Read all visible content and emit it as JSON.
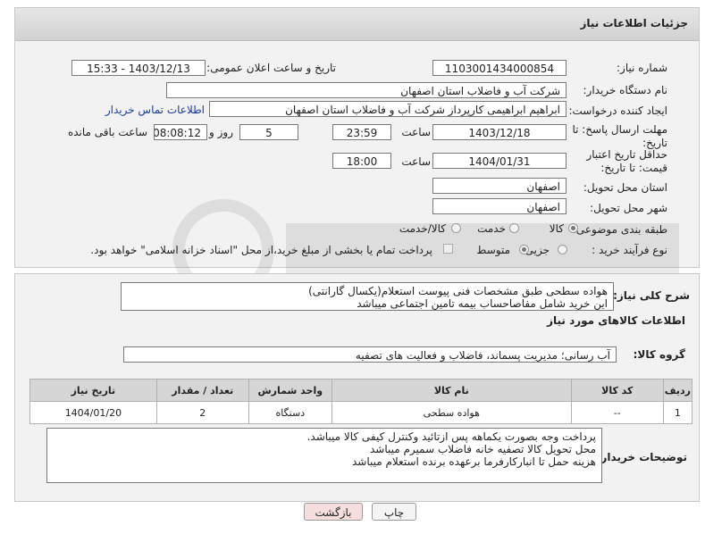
{
  "header": {
    "title": "جزئیات اطلاعات نیاز"
  },
  "fields": {
    "need_number_label": "شماره نیاز:",
    "need_number": "1103001434000854",
    "announce_label": "تاریخ و ساعت اعلان عمومی:",
    "announce_value": "1403/12/13 - 15:33",
    "buyer_org_label": "نام دستگاه خریدار:",
    "buyer_org": "شرکت آب و فاضلاب استان اصفهان",
    "creator_label": "ایجاد کننده درخواست:",
    "creator": "ابراهیم ابراهیمی کارپرداز شرکت آب و فاضلاب استان اصفهان",
    "contact_link": "اطلاعات تماس خریدار",
    "deadline_label": "مهلت ارسال پاسخ: تا تاریخ:",
    "deadline_date": "1403/12/18",
    "time_label": "ساعت",
    "deadline_time": "23:59",
    "days_remaining": "5",
    "days_and_label": "روز و",
    "time_remaining": "08:08:12",
    "remaining_label": "ساعت باقی مانده",
    "validity_label": "حداقل تاریخ اعتبار قیمت: تا تاریخ:",
    "validity_date": "1404/01/31",
    "validity_time": "18:00",
    "province_label": "استان محل تحویل:",
    "province": "اصفهان",
    "city_label": "شهر محل تحویل:",
    "city": "اصفهان",
    "category_label": "طبقه بندی موضوعی:",
    "category_options": [
      "کالا",
      "خدمت",
      "کالا/خدمت"
    ],
    "process_label": "نوع فرآیند خرید :",
    "process_options": [
      "جزیی",
      "متوسط"
    ],
    "payment_note": "پرداخت تمام یا بخشی از مبلغ خرید،از محل \"اسناد خزانه اسلامی\" خواهد بود."
  },
  "description": {
    "label": "شرح کلی نیاز:",
    "line1": "هواده سطحی طبق مشخصات فنی پیوست استعلام(یکسال گارانتی)",
    "line2": "این خرید شامل مفاصاحساب بیمه تامین اجتماعی میباشد"
  },
  "goods": {
    "section_title": "اطلاعات کالاهای مورد نیاز",
    "group_label": "گروه کالا:",
    "group_value": "آب رسانی؛ مدیریت پسماند، فاضلاب و فعالیت های تصفیه",
    "columns": [
      "ردیف",
      "کد کالا",
      "نام کالا",
      "واحد شمارش",
      "تعداد / مقدار",
      "تاریخ نیاز"
    ],
    "rows": [
      [
        "1",
        "--",
        "هواده سطحی",
        "دستگاه",
        "2",
        "1404/01/20"
      ]
    ]
  },
  "buyer_notes": {
    "label": "توضیحات خریدار:",
    "line1": "پرداخت وجه بصورت یکماهه پس ازتائید وکنترل کیفی کالا میباشد.",
    "line2": "محل تحویل کالا تصفیه خانه فاضلاب سمیرم میباشد",
    "line3": "هزینه حمل تا انبارکارفرما برعهده برنده استعلام میباشد"
  },
  "buttons": {
    "print": "چاپ",
    "back": "بازگشت"
  },
  "colors": {
    "link": "#1a3c9c",
    "back_button_bg": "#f7dede",
    "print_button_bg": "#f4f4f4"
  }
}
